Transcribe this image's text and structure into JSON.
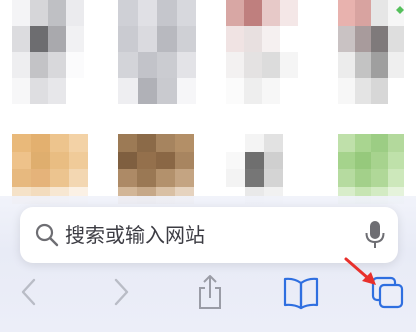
{
  "search": {
    "placeholder": "搜索或输入网站"
  },
  "colors": {
    "accent": "#2f6fe0",
    "disabled_icon": "#b9bcc6",
    "share_icon": "#9a9ca6",
    "arrow_annotation": "#e8302c"
  },
  "toolbar": {
    "items": [
      "back-icon",
      "forward-icon",
      "share-icon",
      "bookmarks-icon",
      "tabs-icon"
    ]
  },
  "favorites": [
    {
      "name": "favorite-tile-1",
      "palette": [
        "#f4f4f6",
        "#d6d6d9",
        "#bfc0c4",
        "#ebebee",
        "#dcdcdf",
        "#6d6d70",
        "#a9a9ad",
        "#f1f1f3",
        "#eeeef0",
        "#c3c3c6",
        "#d8d8db",
        "#fbfbfc",
        "#f7f7f8",
        "#dedee1",
        "#e7e7ea",
        "#ffffff"
      ]
    },
    {
      "name": "favorite-tile-2",
      "palette": [
        "#cfd0d6",
        "#e0e0e5",
        "#c5c6cc",
        "#d7d8dd",
        "#cacbd1",
        "#dadadf",
        "#b8b9bf",
        "#cfd0d5",
        "#d3d4d9",
        "#c2c3c9",
        "#cbccd1",
        "#e3e3e7",
        "#eeeef1",
        "#b0b1b7",
        "#c9cacf",
        "#f6f6f8"
      ]
    },
    {
      "name": "favorite-tile-3",
      "palette": [
        "#d8a7a4",
        "#bf7f7e",
        "#e7c9c8",
        "#f4e7e7",
        "#f0e3e3",
        "#e8e0e0",
        "#f5f0f0",
        "#ffffff",
        "#f3f1f1",
        "#e4e2e2",
        "#dcdcdc",
        "#f5f5f5",
        "#fbfbfb",
        "#eeeeee",
        "#f7f7f7",
        "#ffffff"
      ]
    },
    {
      "name": "favorite-tile-4",
      "palette": [
        "#e8b2ae",
        "#d8a3a0",
        "#e6e6e6",
        "#f6f6f6",
        "#c9c2c3",
        "#a89b9c",
        "#7f7a7b",
        "#dedede",
        "#ececec",
        "#c3c3c3",
        "#9f9f9f",
        "#efefef",
        "#f7f7f7",
        "#e4e4e4",
        "#d7d7d7",
        "#ffffff"
      ]
    },
    {
      "name": "favorite-tile-5",
      "palette": [
        "#e9b97a",
        "#e3b06f",
        "#edc48d",
        "#f3d2a6",
        "#eec28a",
        "#dfae6e",
        "#e9bd82",
        "#f0cb99",
        "#e7b97f",
        "#e5b37a",
        "#ecc48f",
        "#f3d7b2",
        "#f5e2c8",
        "#f3dcbe",
        "#f7e7d2",
        "#fbf1e5"
      ]
    },
    {
      "name": "favorite-tile-6",
      "palette": [
        "#9c7a55",
        "#8b6a48",
        "#a6845f",
        "#b38f67",
        "#7f5f40",
        "#94704c",
        "#8a6745",
        "#a88560",
        "#ad8a66",
        "#9a7854",
        "#b3916c",
        "#c4a482",
        "#d2b697",
        "#c6a888",
        "#d9c0a4",
        "#e6d3bf"
      ]
    },
    {
      "name": "favorite-tile-7",
      "palette": [
        "#ffffff",
        "#f4f4f4",
        "#e2e2e2",
        "#ffffff",
        "#f8f8f8",
        "#6f6f6f",
        "#cfcfcf",
        "#ffffff",
        "#f3f3f3",
        "#767676",
        "#d4d4d4",
        "#ffffff",
        "#ffffff",
        "#e9e9e9",
        "#f1f1f1",
        "#ffffff"
      ]
    },
    {
      "name": "favorite-tile-8",
      "palette": [
        "#bfe0aa",
        "#a9d590",
        "#9ccd84",
        "#b3d99c",
        "#a5d38c",
        "#96c97c",
        "#a7d38e",
        "#bfe1aa",
        "#b6dba0",
        "#a3d08a",
        "#b0d898",
        "#cde8bb",
        "#d8edca",
        "#c7e5b3",
        "#d3ebc3",
        "#e5f3db"
      ]
    }
  ]
}
